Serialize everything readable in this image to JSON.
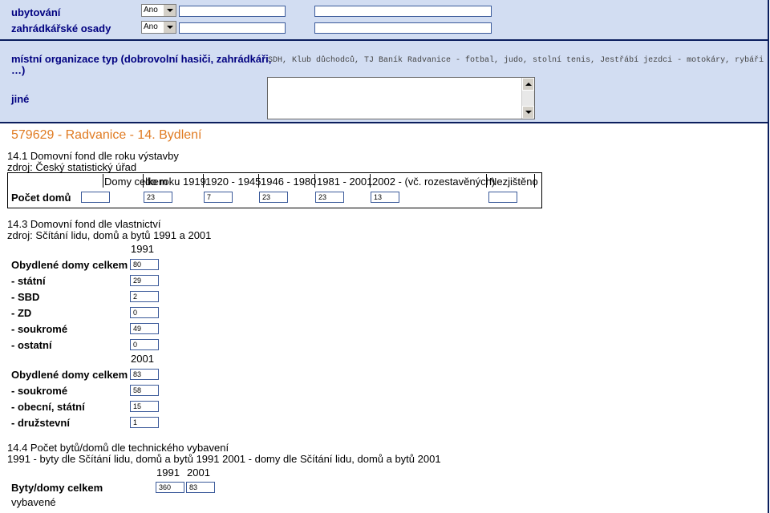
{
  "form": {
    "ubytovani": {
      "label": "ubytování",
      "select": "Ano"
    },
    "zahradkarske": {
      "label": "zahrádkářské osady",
      "select": "Ano"
    },
    "mistni": {
      "label_line1": "místní organizace typ (dobrovolní hasiči, zahrádkáři,",
      "label_line2": "…)",
      "value": "SDH, Klub důchodců, TJ Baník Radvanice - fotbal, judo, stolní tenis, Jestřábí jezdci - motokáry, rybáři"
    },
    "jine": {
      "label": "jiné"
    }
  },
  "section": {
    "title": "579629 - Radvanice - 14. Bydlení"
  },
  "s141": {
    "title": "14.1 Domovní fond dle roku výstavby",
    "source": "zdroj: Český statistický úřad",
    "headers": [
      "Domy celkem",
      "do roku 1919",
      "1920 - 1945",
      "1946 - 1980",
      "1981 - 2001",
      "2002 - (vč. rozestavěných)",
      "Nezjištěno"
    ],
    "row_label": "Počet domů",
    "values": [
      "",
      "23",
      "7",
      "23",
      "23",
      "13",
      ""
    ]
  },
  "s143": {
    "title": "14.3 Domovní fond dle vlastnictví",
    "source": "zdroj: Sčítání lidu, domů a bytů 1991 a 2001",
    "year1": "1991",
    "rows1": [
      {
        "label": "Obydlené domy celkem",
        "value": "80"
      },
      {
        "label": "- státní",
        "value": "29"
      },
      {
        "label": "- SBD",
        "value": "2"
      },
      {
        "label": "- ZD",
        "value": "0"
      },
      {
        "label": "- soukromé",
        "value": "49"
      },
      {
        "label": "- ostatní",
        "value": "0"
      }
    ],
    "year2": "2001",
    "rows2": [
      {
        "label": "Obydlené domy celkem",
        "value": "83"
      },
      {
        "label": "- soukromé",
        "value": "58"
      },
      {
        "label": "- obecní, státní",
        "value": "15"
      },
      {
        "label": "- družstevní",
        "value": "1"
      }
    ]
  },
  "s144": {
    "title": "14.4 Počet bytů/domů dle technického vybavení",
    "source": "1991 - byty dle Sčítání lidu, domů a bytů 1991 2001 - domy dle Sčítání lidu, domů a bytů 2001",
    "col1": "1991",
    "col2": "2001",
    "rows": [
      {
        "label": "Byty/domy celkem",
        "v1": "360",
        "v2": "83"
      },
      {
        "label": "vybavené"
      }
    ]
  }
}
